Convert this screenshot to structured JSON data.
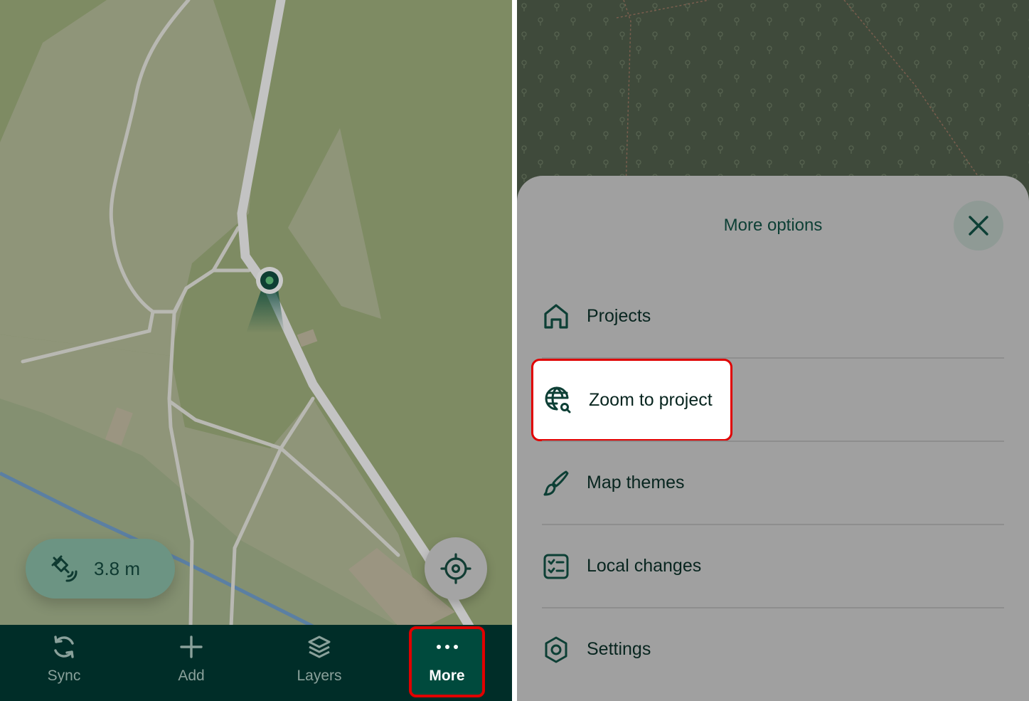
{
  "map_view": {
    "accuracy_label": "3.8 m",
    "colors": {
      "map_green": "#7e8b63",
      "forest_area": "#8f9579",
      "path": "#c3c3c3",
      "water": "#5b7fa3",
      "position_marker": "#0e4a3c"
    }
  },
  "bottom_nav": {
    "items": [
      {
        "label": "Sync",
        "icon": "sync-icon"
      },
      {
        "label": "Add",
        "icon": "plus-icon"
      },
      {
        "label": "Layers",
        "icon": "layers-icon"
      },
      {
        "label": "More",
        "icon": "more-dots-icon",
        "active": true
      }
    ],
    "background": "#002d28",
    "active_background": "#004a3d"
  },
  "more_sheet": {
    "title": "More options",
    "items": [
      {
        "label": "Projects",
        "icon": "home-icon"
      },
      {
        "label": "Zoom to project",
        "icon": "globe-search-icon",
        "highlighted": true
      },
      {
        "label": "Map themes",
        "icon": "brush-icon"
      },
      {
        "label": "Local changes",
        "icon": "checklist-icon"
      },
      {
        "label": "Settings",
        "icon": "gear-icon"
      }
    ],
    "highlight_color": "#e00000"
  }
}
